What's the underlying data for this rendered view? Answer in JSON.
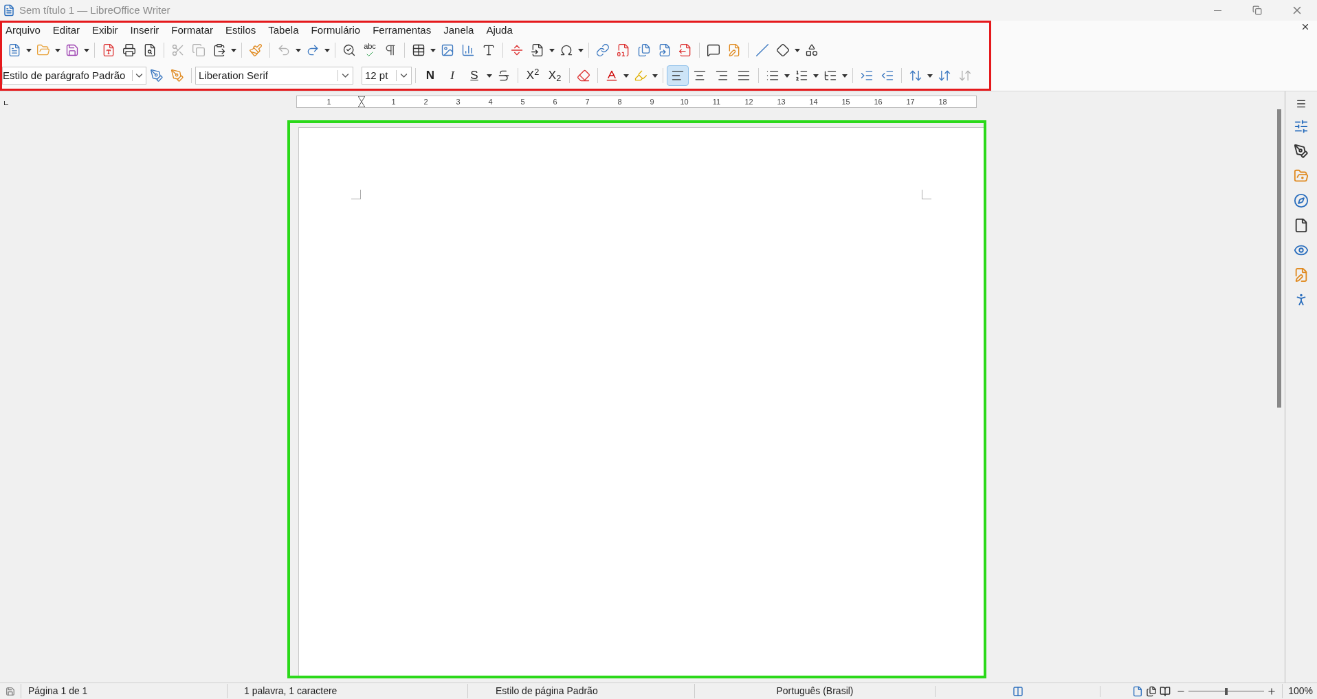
{
  "window": {
    "title": "Sem título 1 — LibreOffice Writer"
  },
  "menu": [
    {
      "label": "Arquivo"
    },
    {
      "label": "Editar"
    },
    {
      "label": "Exibir"
    },
    {
      "label": "Inserir"
    },
    {
      "label": "Formatar"
    },
    {
      "label": "Estilos"
    },
    {
      "label": "Tabela"
    },
    {
      "label": "Formulário"
    },
    {
      "label": "Ferramentas"
    },
    {
      "label": "Janela"
    },
    {
      "label": "Ajuda"
    }
  ],
  "spellcheck_label": "abc",
  "formatting": {
    "paragraph_style": "Estilo de parágrafo Padrão",
    "font_name": "Liberation Serif",
    "font_size": "12 pt"
  },
  "text_buttons": [
    {
      "label": "N",
      "kind": "bold"
    },
    {
      "label": "I",
      "kind": "italic"
    },
    {
      "label": "S",
      "kind": "underline"
    },
    {
      "label": "X$^{2}$",
      "kind": "plain"
    },
    {
      "label": "X$_{2}$",
      "kind": "plain"
    }
  ],
  "alignment": [
    {
      "selected": true
    },
    {
      "selected": false
    },
    {
      "selected": false
    },
    {
      "selected": false
    }
  ],
  "ruler": {
    "labels": [
      "1",
      "1",
      "2",
      "3",
      "4",
      "5",
      "6",
      "7",
      "8",
      "9",
      "10",
      "11",
      "12",
      "13",
      "14",
      "15",
      "16",
      "17",
      "18"
    ]
  },
  "status_bar": {
    "page": "Página 1 de 1",
    "words": "1 palavra, 1 caractere",
    "page_style": "Estilo de página Padrão",
    "language": "Português (Brasil)",
    "zoom_slider": {
      "level": 0.5
    },
    "zoom": "100%"
  }
}
